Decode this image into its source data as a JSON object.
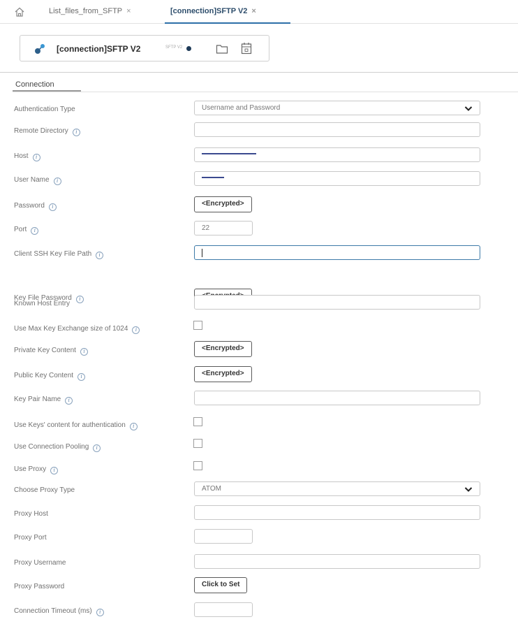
{
  "tabs": {
    "tab1": {
      "label": "List_files_from_SFTP",
      "close": "×"
    },
    "tab2": {
      "label": "[connection]SFTP V2",
      "close": "×"
    }
  },
  "header": {
    "title": "[connection]SFTP V2",
    "subtitle": "SFTP V2"
  },
  "section_tab": "Connection",
  "fields": {
    "auth_type": {
      "label": "Authentication Type",
      "value": "Username and Password"
    },
    "remote_dir": {
      "label": "Remote Directory",
      "value": ""
    },
    "host": {
      "label": "Host",
      "value": ""
    },
    "user_name": {
      "label": "User Name",
      "value": ""
    },
    "password": {
      "label": "Password",
      "value": "<Encrypted>"
    },
    "port": {
      "label": "Port",
      "value": "22"
    },
    "ssh_key_path": {
      "label": "Client SSH Key File Path",
      "value": ""
    },
    "key_file_password": {
      "label": "Key File Password",
      "value": "<Encrypted>"
    },
    "known_host": {
      "label": "Known Host Entry",
      "value": ""
    },
    "max_key_exchange": {
      "label": "Use Max Key Exchange size of 1024",
      "checked": false
    },
    "private_key": {
      "label": "Private Key Content",
      "value": "<Encrypted>"
    },
    "public_key": {
      "label": "Public Key Content",
      "value": "<Encrypted>"
    },
    "key_pair_name": {
      "label": "Key Pair Name",
      "value": ""
    },
    "use_keys_content": {
      "label": "Use Keys' content for authentication",
      "checked": false
    },
    "connection_pooling": {
      "label": "Use Connection Pooling",
      "checked": false
    },
    "use_proxy": {
      "label": "Use Proxy",
      "checked": false
    },
    "proxy_type": {
      "label": "Choose Proxy Type",
      "value": "ATOM"
    },
    "proxy_host": {
      "label": "Proxy Host",
      "value": ""
    },
    "proxy_port": {
      "label": "Proxy Port",
      "value": ""
    },
    "proxy_username": {
      "label": "Proxy Username",
      "value": ""
    },
    "proxy_password": {
      "label": "Proxy Password",
      "value": "Click to Set"
    },
    "connection_timeout": {
      "label": "Connection Timeout (ms)",
      "value": ""
    }
  },
  "icons": {
    "home": "home-icon",
    "info": "info-icon",
    "folder": "folder-icon",
    "calendar": "calendar-icon",
    "chevron": "chevron-down-icon"
  },
  "colors": {
    "accent": "#2d6fa8",
    "focus_border": "#3d7aa8",
    "status_dot": "#1f3b58",
    "redaction": "#3b4a8f"
  }
}
